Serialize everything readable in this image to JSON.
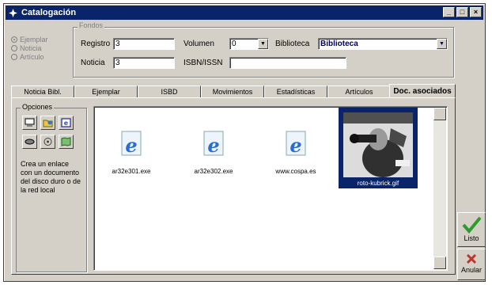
{
  "window": {
    "title": "Catalogación"
  },
  "mode_radios": [
    {
      "label": "Ejemplar",
      "selected": true
    },
    {
      "label": "Noticia",
      "selected": false
    },
    {
      "label": "Artículo",
      "selected": false
    }
  ],
  "fondos": {
    "legend": "Fondos",
    "registro_label": "Registro",
    "registro_value": "3",
    "noticia_label": "Noticia",
    "noticia_value": "3",
    "volumen_label": "Volumen",
    "volumen_value": "0",
    "biblioteca_label": "Biblioteca",
    "biblioteca_value": "Biblioteca",
    "isbn_label": "ISBN/ISSN",
    "isbn_value": ""
  },
  "tabs": [
    {
      "label": "Noticia Bibl."
    },
    {
      "label": "Ejemplar"
    },
    {
      "label": "ISBD"
    },
    {
      "label": "Movimientos"
    },
    {
      "label": "Estadísticas"
    },
    {
      "label": "Artículos"
    },
    {
      "label": "Doc. asociados"
    }
  ],
  "opciones": {
    "legend": "Opciones",
    "help": "Crea un enlace con un documento del disco duro o de la red local"
  },
  "files": [
    {
      "name": "ar32e301.exe"
    },
    {
      "name": "ar32e302.exe"
    },
    {
      "name": "www.cospa.es"
    },
    {
      "name": "roto-kubrick.gif"
    }
  ],
  "actions": {
    "ok_label": "Listo",
    "cancel_label": "Anular"
  },
  "colors": {
    "titlebar": "#0a246a",
    "face": "#d4d0c8",
    "ok": "#2e9b2e",
    "cancel": "#c0342c"
  }
}
